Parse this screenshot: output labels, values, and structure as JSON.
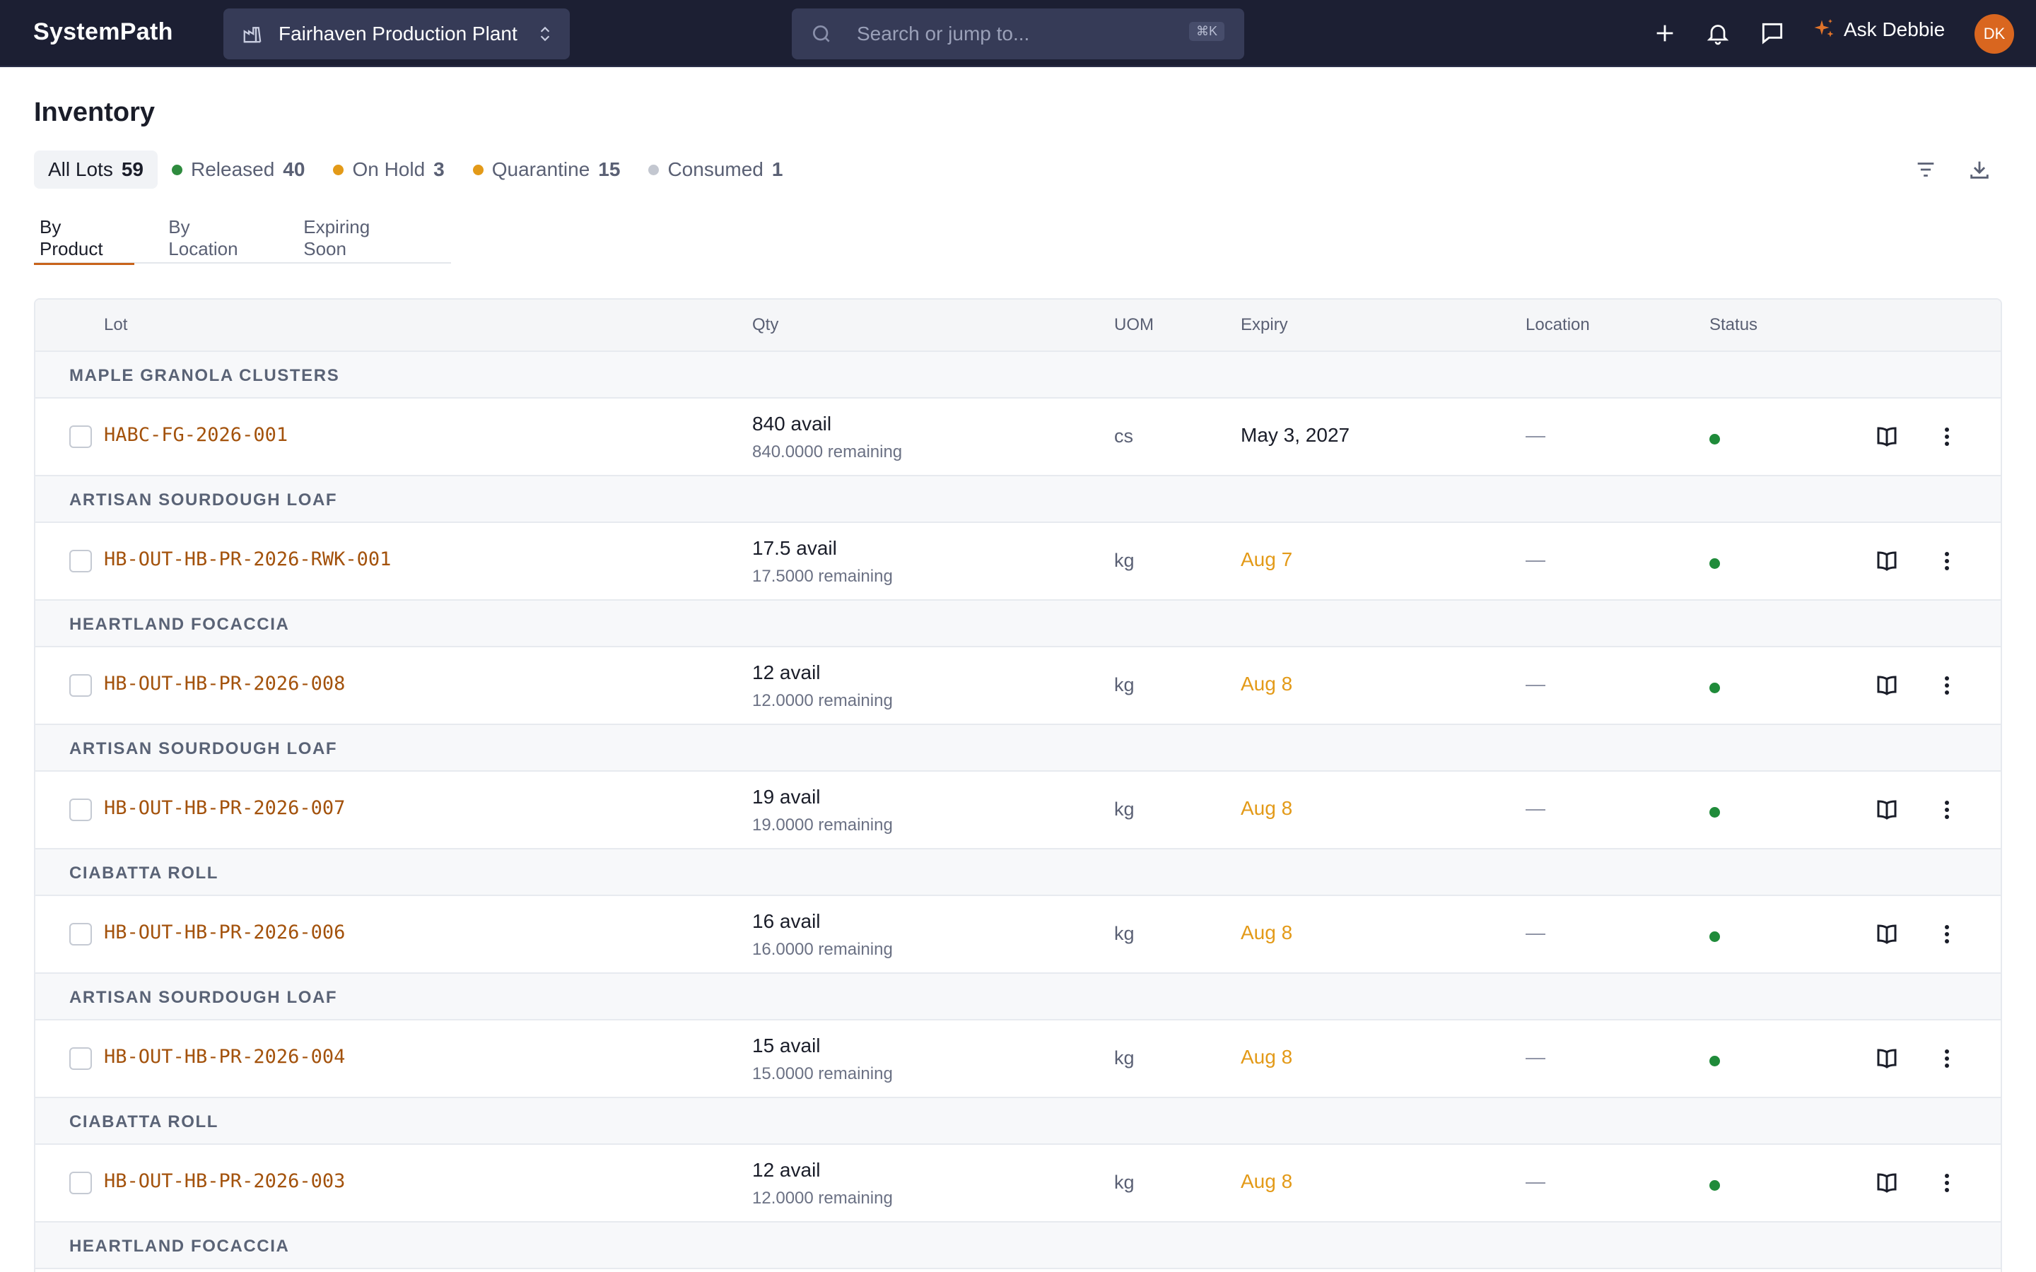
{
  "app": {
    "brand": "SystemPath"
  },
  "plant_selector": {
    "label": "Fairhaven Production Plant"
  },
  "search": {
    "placeholder": "Search or jump to...",
    "shortcut": "⌘K"
  },
  "topbar": {
    "ask_label": "Ask Debbie",
    "avatar_initials": "DK"
  },
  "page": {
    "title": "Inventory"
  },
  "filters": [
    {
      "label": "All Lots",
      "count": "59",
      "dot": null
    },
    {
      "label": "Released",
      "count": "40",
      "dot": "#2e8b3e"
    },
    {
      "label": "On Hold",
      "count": "3",
      "dot": "#e39a18"
    },
    {
      "label": "Quarantine",
      "count": "15",
      "dot": "#e39a18"
    },
    {
      "label": "Consumed",
      "count": "1",
      "dot": "#c3c7d0"
    }
  ],
  "tabs": [
    {
      "label": "By Product"
    },
    {
      "label": "By Location"
    },
    {
      "label": "Expiring Soon"
    }
  ],
  "table": {
    "columns": {
      "lot": "Lot",
      "qty": "Qty",
      "uom": "UOM",
      "expiry": "Expiry",
      "location": "Location",
      "status": "Status"
    },
    "groups": [
      {
        "product": "MAPLE GRANOLA CLUSTERS",
        "lot": "HABC-FG-2026-001",
        "qty": "840 avail",
        "remaining": "840.0000 remaining",
        "uom": "cs",
        "expiry": "May 3, 2027",
        "expiry_soon": false,
        "location": "—"
      },
      {
        "product": "ARTISAN SOURDOUGH LOAF",
        "lot": "HB-OUT-HB-PR-2026-RWK-001",
        "qty": "17.5 avail",
        "remaining": "17.5000 remaining",
        "uom": "kg",
        "expiry": "Aug 7",
        "expiry_soon": true,
        "location": "—"
      },
      {
        "product": "HEARTLAND FOCACCIA",
        "lot": "HB-OUT-HB-PR-2026-008",
        "qty": "12 avail",
        "remaining": "12.0000 remaining",
        "uom": "kg",
        "expiry": "Aug 8",
        "expiry_soon": true,
        "location": "—"
      },
      {
        "product": "ARTISAN SOURDOUGH LOAF",
        "lot": "HB-OUT-HB-PR-2026-007",
        "qty": "19 avail",
        "remaining": "19.0000 remaining",
        "uom": "kg",
        "expiry": "Aug 8",
        "expiry_soon": true,
        "location": "—"
      },
      {
        "product": "CIABATTA ROLL",
        "lot": "HB-OUT-HB-PR-2026-006",
        "qty": "16 avail",
        "remaining": "16.0000 remaining",
        "uom": "kg",
        "expiry": "Aug 8",
        "expiry_soon": true,
        "location": "—"
      },
      {
        "product": "ARTISAN SOURDOUGH LOAF",
        "lot": "HB-OUT-HB-PR-2026-004",
        "qty": "15 avail",
        "remaining": "15.0000 remaining",
        "uom": "kg",
        "expiry": "Aug 8",
        "expiry_soon": true,
        "location": "—"
      },
      {
        "product": "CIABATTA ROLL",
        "lot": "HB-OUT-HB-PR-2026-003",
        "qty": "12 avail",
        "remaining": "12.0000 remaining",
        "uom": "kg",
        "expiry": "Aug 8",
        "expiry_soon": true,
        "location": "—"
      },
      {
        "product": "HEARTLAND FOCACCIA"
      }
    ]
  },
  "colors": {
    "accent": "#c8631b",
    "expiry_soon": "#e39a18",
    "status_released": "#1f8b3a",
    "topbar": "#1c1f33"
  }
}
